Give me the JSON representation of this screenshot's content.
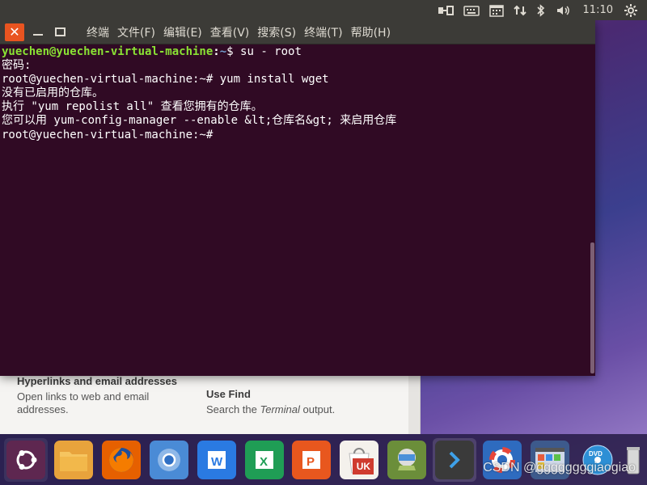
{
  "top_panel": {
    "clock": "11:10",
    "indicators": [
      "network-transfer-icon",
      "keyboard-icon",
      "calendar-icon",
      "updown-arrows-icon",
      "bluetooth-icon",
      "volume-icon",
      "settings-gear-icon"
    ]
  },
  "terminal": {
    "menu": [
      "终端",
      "文件(F)",
      "编辑(E)",
      "查看(V)",
      "搜索(S)",
      "终端(T)",
      "帮助(H)"
    ],
    "prompt_user": "yuechen@yuechen-virtual-machine",
    "prompt_path": "~",
    "prompt_suffix": "$ ",
    "cmd1": "su - root",
    "password_prompt": "密码:",
    "root_prompt": "root@yuechen-virtual-machine:~# ",
    "cmd2": "yum install wget",
    "out1": "没有已启用的仓库。",
    "out2": "执行 \"yum repolist all\" 查看您拥有的仓库。",
    "out3": "您可以用 yum-config-manager --enable &lt;仓库名&gt; 来启用仓库",
    "root_prompt2": "root@yuechen-virtual-machine:~# "
  },
  "help_window": {
    "item1_title": "Hyperlinks and email addresses",
    "item1_desc_line1": "Open links to web and email",
    "item1_desc_line2": "addresses.",
    "item2_title": "Use Find",
    "item2_desc_prefix": "Search the ",
    "item2_desc_em": "Terminal",
    "item2_desc_suffix": " output."
  },
  "launcher": {
    "items": [
      "ubuntu-dash-icon",
      "files-icon",
      "firefox-icon",
      "chromium-icon",
      "wps-writer-icon",
      "wps-spreadsheet-icon",
      "wps-presentation-icon",
      "software-center-icon",
      "update-manager-icon",
      "terminal-icon",
      "help-icon",
      "workspace-icon",
      "dvd-icon",
      "trash-icon"
    ],
    "software_center_badge": "UK"
  },
  "watermark": "CSDN @ggggggggiaogiao",
  "colors": {
    "terminal_bg": "#300a24",
    "prompt_green": "#8ae234",
    "prompt_blue": "#729fcf",
    "panel_bg": "#3c3b37",
    "close_orange": "#e95420"
  }
}
